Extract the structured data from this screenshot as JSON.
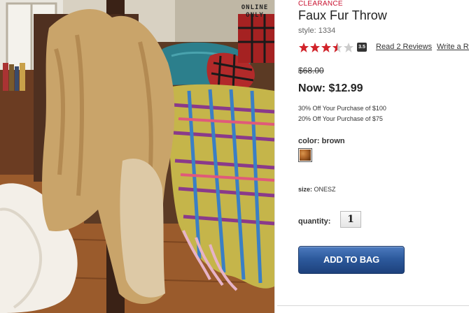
{
  "image": {
    "badge_text": "ONLINE ONLY",
    "description": "product-photo"
  },
  "product": {
    "tag": "CLEARANCE",
    "title": "Faux Fur Throw",
    "style_label": "style:",
    "style_number": "1334",
    "rating": {
      "value": 3.5,
      "max": 5,
      "badge": "3.5",
      "reviews_link": "Read 2 Reviews",
      "write_link": "Write a Re"
    },
    "original_price": "$68.00",
    "now_price": "Now: $12.99",
    "promos": [
      "30% Off Your Purchase of $100",
      "20% Off Your Purchase of $75"
    ],
    "color_label": "color:",
    "color_value": "brown",
    "size_label": "size:",
    "size_value": "ONESZ",
    "quantity_label": "quantity:",
    "quantity_value": "1",
    "add_to_bag": "ADD TO BAG"
  },
  "colors": {
    "clearance": "#c8102e",
    "star": "#d1232a",
    "button": "#2d5a9d"
  }
}
